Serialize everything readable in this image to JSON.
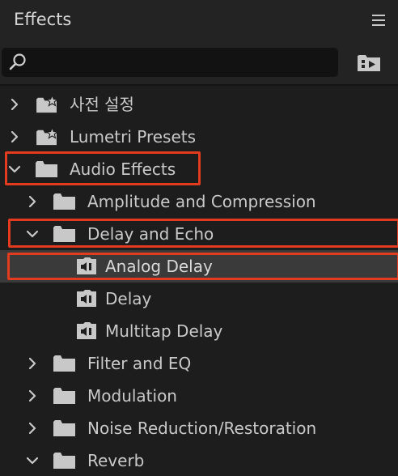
{
  "panel": {
    "title": "Effects",
    "menu_icon": "hamburger-menu-icon"
  },
  "search": {
    "value": "",
    "placeholder": "",
    "icon": "search-icon",
    "new_bin_icon": "new-custom-bin-icon"
  },
  "tree": {
    "items": [
      {
        "label": "사전 설정",
        "icon": "preset-folder-icon",
        "state": "collapsed"
      },
      {
        "label": "Lumetri Presets",
        "icon": "preset-folder-icon",
        "state": "collapsed"
      },
      {
        "label": "Audio Effects",
        "icon": "folder-icon",
        "state": "expanded"
      },
      {
        "label": "Amplitude and Compression",
        "icon": "folder-icon",
        "state": "collapsed"
      },
      {
        "label": "Delay and Echo",
        "icon": "folder-icon",
        "state": "expanded"
      },
      {
        "label": "Analog Delay",
        "icon": "audio-effect-icon",
        "state": "selected"
      },
      {
        "label": "Delay",
        "icon": "audio-effect-icon",
        "state": "leaf"
      },
      {
        "label": "Multitap Delay",
        "icon": "audio-effect-icon",
        "state": "leaf"
      },
      {
        "label": "Filter and EQ",
        "icon": "folder-icon",
        "state": "collapsed"
      },
      {
        "label": "Modulation",
        "icon": "folder-icon",
        "state": "collapsed"
      },
      {
        "label": "Noise Reduction/Restoration",
        "icon": "folder-icon",
        "state": "collapsed"
      },
      {
        "label": "Reverb",
        "icon": "folder-icon",
        "state": "expanded"
      }
    ]
  },
  "colors": {
    "background": "#1d1d1d",
    "header": "#232323",
    "selection": "#3a3a3a",
    "highlight": "#e23b1e",
    "icon": "#c8c8c8"
  }
}
